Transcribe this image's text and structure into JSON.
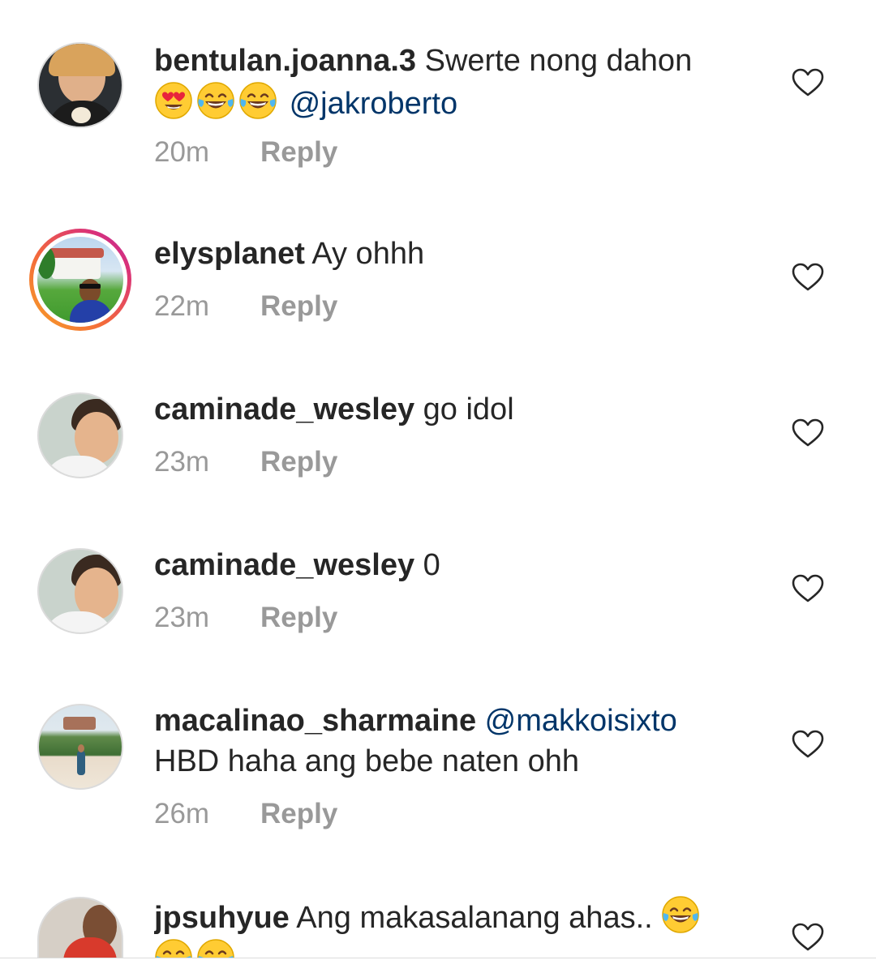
{
  "comments": [
    {
      "username": "bentulan.joanna.3",
      "text": "Swerte nong dahon",
      "emojis": [
        "heart-eyes-emoji",
        "laughing-tears-emoji",
        "laughing-tears-emoji"
      ],
      "mention": "@jakroberto",
      "time": "20m",
      "reply": "Reply"
    },
    {
      "username": "elysplanet",
      "text": "Ay ohhh",
      "time": "22m",
      "reply": "Reply"
    },
    {
      "username": "caminade_wesley",
      "text": "go idol",
      "time": "23m",
      "reply": "Reply"
    },
    {
      "username": "caminade_wesley",
      "text": "0",
      "time": "23m",
      "reply": "Reply"
    },
    {
      "username": "macalinao_sharmaine",
      "mention": "@makkoisixto",
      "text": "HBD haha ang bebe naten ohh",
      "time": "26m",
      "reply": "Reply"
    },
    {
      "username": "jpsuhyue",
      "text": "Ang makasalanang ahas..",
      "emojis": [
        "laughing-tears-emoji",
        "laughing-tears-emoji",
        "laughing-tears-emoji"
      ]
    }
  ],
  "colors": {
    "text": "#262626",
    "meta": "#999999",
    "mention": "#003569",
    "story_ring_start": "#f7a325",
    "story_ring_end": "#b12da6"
  },
  "icons": {
    "like": "heart-outline-icon"
  }
}
